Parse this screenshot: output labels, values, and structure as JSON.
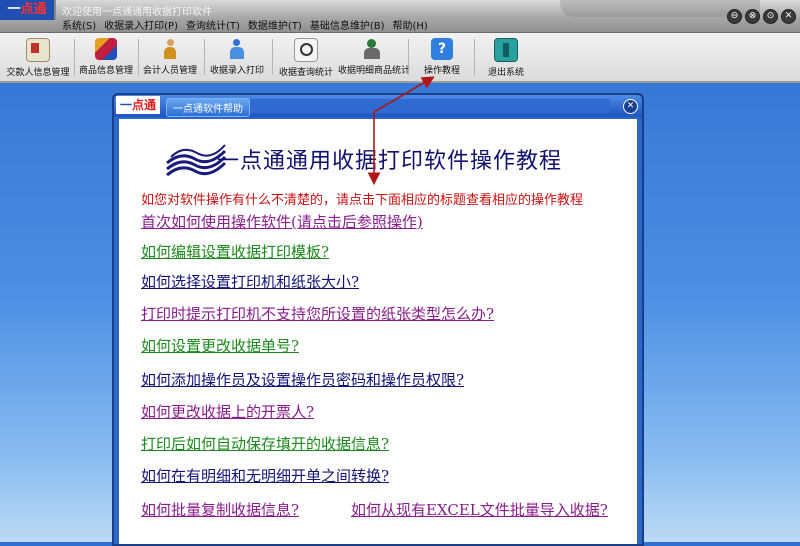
{
  "app": {
    "logo_main": "一",
    "logo_accent": "点通",
    "window_title": "欢迎使用一点通通用收据打印软件",
    "window_controls": [
      "⊖",
      "⊗",
      "⊙",
      "✕"
    ]
  },
  "menu": [
    "系统(S)",
    "收据录入打印(P)",
    "查询统计(T)",
    "数据维护(T)",
    "基础信息维护(B)",
    "帮助(H)"
  ],
  "toolbar": {
    "buttons": [
      {
        "label": "交款人信息管理",
        "icon": "id-card-icon"
      },
      {
        "label": "商品信息管理",
        "icon": "cubes-icon"
      },
      {
        "label": "会计人员管理",
        "icon": "person-icon"
      },
      {
        "label": "收据录入打印",
        "icon": "user-entry-icon"
      },
      {
        "label": "收据查询统计",
        "icon": "magnifier-icon"
      },
      {
        "label": "收据明细商品统计",
        "icon": "detail-stats-icon"
      },
      {
        "label": "操作教程",
        "icon": "help-icon"
      },
      {
        "label": "退出系统",
        "icon": "exit-door-icon"
      }
    ]
  },
  "help_window": {
    "logo_main": "一",
    "logo_accent": "点通",
    "title": "一点通软件帮助",
    "close": "✕",
    "heading": "一点通通用收据打印软件操作教程",
    "intro": "如您对软件操作有什么不清楚的，请点击下面相应的标题查看相应的操作教程",
    "links": [
      "首次如何使用操作软件(请点击后参照操作)",
      "如何编辑设置收据打印模板?",
      "如何选择设置打印机和纸张大小?",
      "打印时提示打印机不支持您所设置的纸张类型怎么办?",
      "如何设置更改收据单号?",
      "如何添加操作员及设置操作员密码和操作员权限?",
      "如何更改收据上的开票人?",
      "打印后如何自动保存填开的收据信息?",
      "如何在有明细和无明细开单之间转换?",
      "如何批量复制收据信息?",
      "如何从现有EXCEL文件批量导入收据?"
    ]
  },
  "colors": {
    "link_purple": "#8a1c8c",
    "link_green": "#1d8a1d",
    "link_navy": "#13137a",
    "intro_red": "#cc1010",
    "arrow_red": "#b01818"
  }
}
